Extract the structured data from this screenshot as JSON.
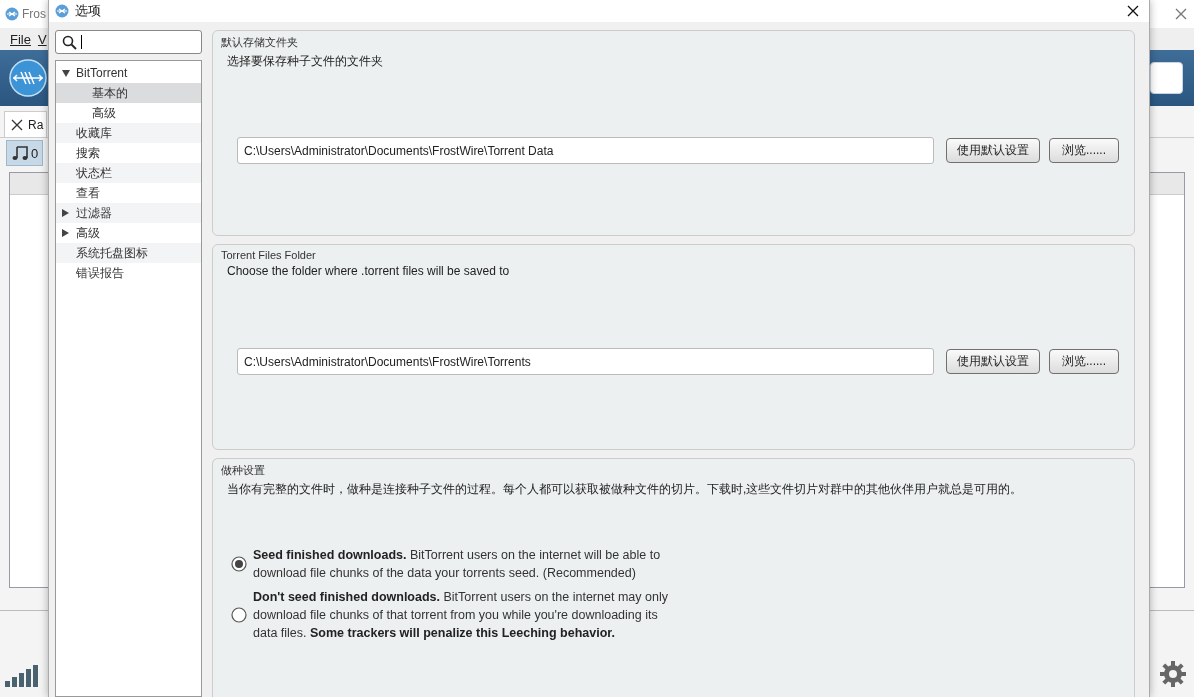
{
  "background_window": {
    "title": "Fros",
    "menu": [
      "File",
      "V"
    ],
    "tab_label": "Ra",
    "music_count": "0"
  },
  "dialog": {
    "title": "选项",
    "tree": [
      {
        "label": "BitTorrent",
        "selected": false,
        "expanded": true,
        "children": [
          {
            "label": "基本的",
            "selected": true
          },
          {
            "label": "高级",
            "selected": false
          }
        ]
      },
      {
        "label": "收藏库",
        "selected": false
      },
      {
        "label": "搜索",
        "selected": false
      },
      {
        "label": "状态栏",
        "selected": false
      },
      {
        "label": "查看",
        "selected": false
      },
      {
        "label": "过滤器",
        "selected": false,
        "expanded": false
      },
      {
        "label": "高级",
        "selected": false,
        "expanded": false
      },
      {
        "label": "系统托盘图标",
        "selected": false
      },
      {
        "label": "错误报告",
        "selected": false
      }
    ],
    "folder_panels": [
      {
        "title": "默认存储文件夹",
        "description": "选择要保存种子文件的文件夹",
        "path": "C:\\Users\\Administrator\\Documents\\FrostWire\\Torrent Data",
        "default_button": "使用默认设置",
        "browse_button": "浏览......"
      },
      {
        "title": "Torrent Files Folder",
        "description": "Choose the folder where .torrent files will be saved to",
        "path": "C:\\Users\\Administrator\\Documents\\FrostWire\\Torrents",
        "default_button": "使用默认设置",
        "browse_button": "浏览......"
      }
    ],
    "seeding": {
      "title": "做种设置",
      "description": "当你有完整的文件时，做种是连接种子文件的过程。每个人都可以获取被做种文件的切片。下载时,这些文件切片对群中的其他伙伴用户就总是可用的。",
      "options": [
        {
          "text": "**Seed finished downloads.** BitTorrent users on the internet will be able to download file chunks of the data your torrents seed. (Recommended)",
          "selected": true
        },
        {
          "text": "**Don't seed finished downloads.** BitTorrent users on the internet may only download file chunks of that torrent from you while you're downloading its data files. **Some trackers will penalize this Leeching behavior.**",
          "selected": false
        }
      ]
    }
  }
}
